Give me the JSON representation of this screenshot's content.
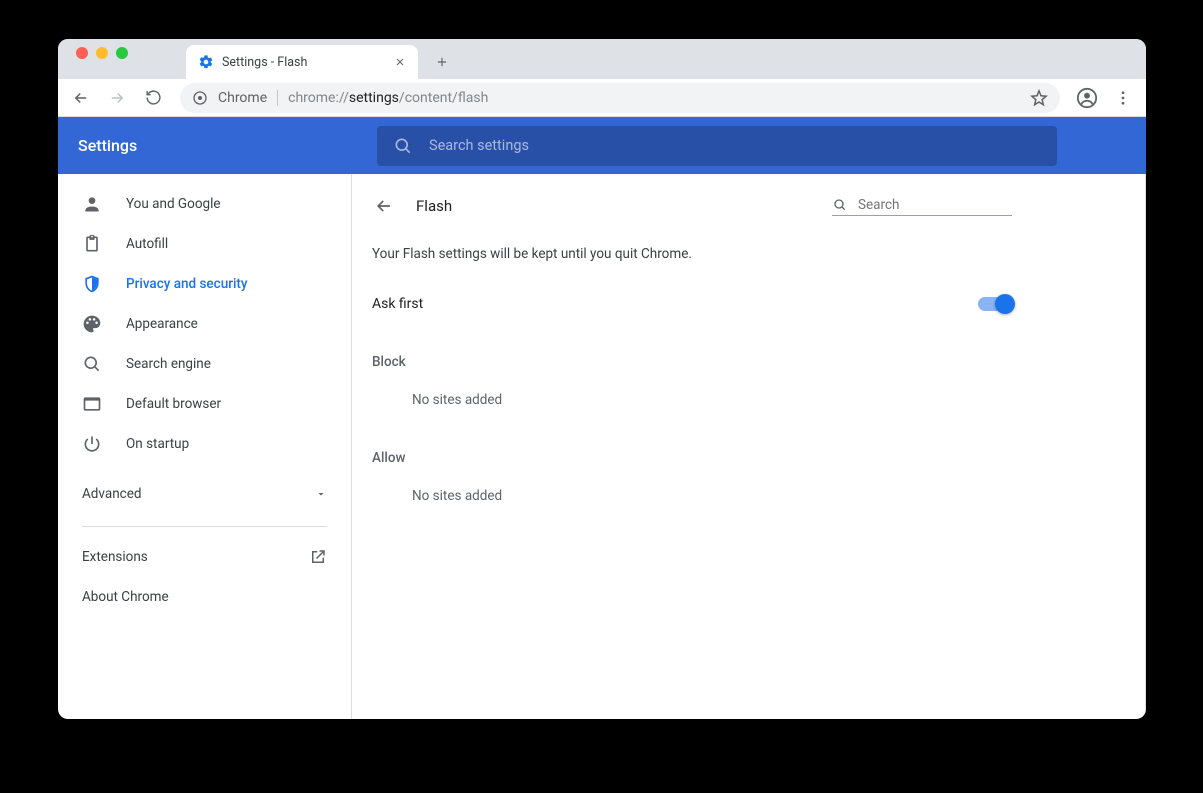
{
  "tab": {
    "title": "Settings - Flash"
  },
  "omnibox": {
    "origin": "Chrome",
    "path_prefix": "chrome://",
    "path_bold": "settings",
    "path_suffix": "/content/flash"
  },
  "header": {
    "title": "Settings",
    "search_placeholder": "Search settings"
  },
  "sidebar": {
    "items": [
      {
        "label": "You and Google"
      },
      {
        "label": "Autofill"
      },
      {
        "label": "Privacy and security"
      },
      {
        "label": "Appearance"
      },
      {
        "label": "Search engine"
      },
      {
        "label": "Default browser"
      },
      {
        "label": "On startup"
      }
    ],
    "advanced_label": "Advanced",
    "extensions_label": "Extensions",
    "about_label": "About Chrome"
  },
  "page": {
    "title": "Flash",
    "local_search_placeholder": "Search",
    "notice": "Your Flash settings will be kept until you quit Chrome.",
    "toggle_label": "Ask first",
    "block_label": "Block",
    "block_empty": "No sites added",
    "allow_label": "Allow",
    "allow_empty": "No sites added"
  }
}
